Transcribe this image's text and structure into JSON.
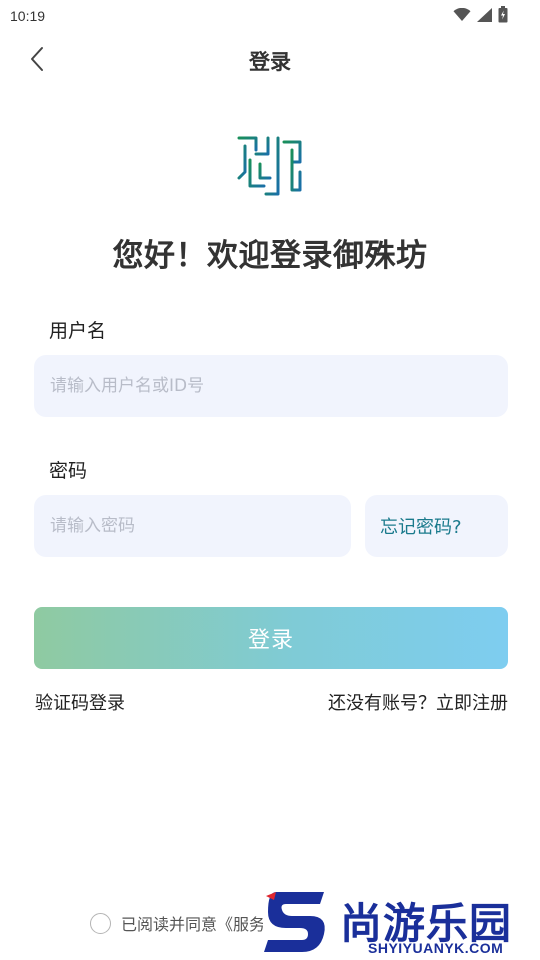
{
  "status_bar": {
    "time": "10:19",
    "icons": [
      "wifi-icon",
      "signal-icon",
      "battery-icon"
    ]
  },
  "nav": {
    "back_icon": "chevron-left-icon",
    "title": "登录"
  },
  "logo": {
    "icon": "app-logo-icon",
    "colors": [
      "#1a8f5a",
      "#1a6fa8"
    ]
  },
  "greeting": "您好！欢迎登录御殊坊",
  "form": {
    "username_label": "用户名",
    "username_placeholder": "请输入用户名或ID号",
    "username_value": "",
    "password_label": "密码",
    "password_placeholder": "请输入密码",
    "password_value": "",
    "forgot_label": "忘记密码?"
  },
  "actions": {
    "login_label": "登录",
    "sms_login_label": "验证码登录",
    "register_label": "还没有账号？立即注册"
  },
  "agreement": {
    "text": "已阅读并同意《服务"
  },
  "watermark": {
    "name": "尚游乐园",
    "url": "SHYIYUANYK.COM"
  },
  "colors": {
    "accent_teal": "#1a7a8c",
    "input_bg": "#f1f4fd",
    "button_gradient_start": "#8fcaa1",
    "button_gradient_end": "#7ecdf0",
    "watermark_blue": "#1a2f9a",
    "watermark_red": "#e0262e"
  }
}
